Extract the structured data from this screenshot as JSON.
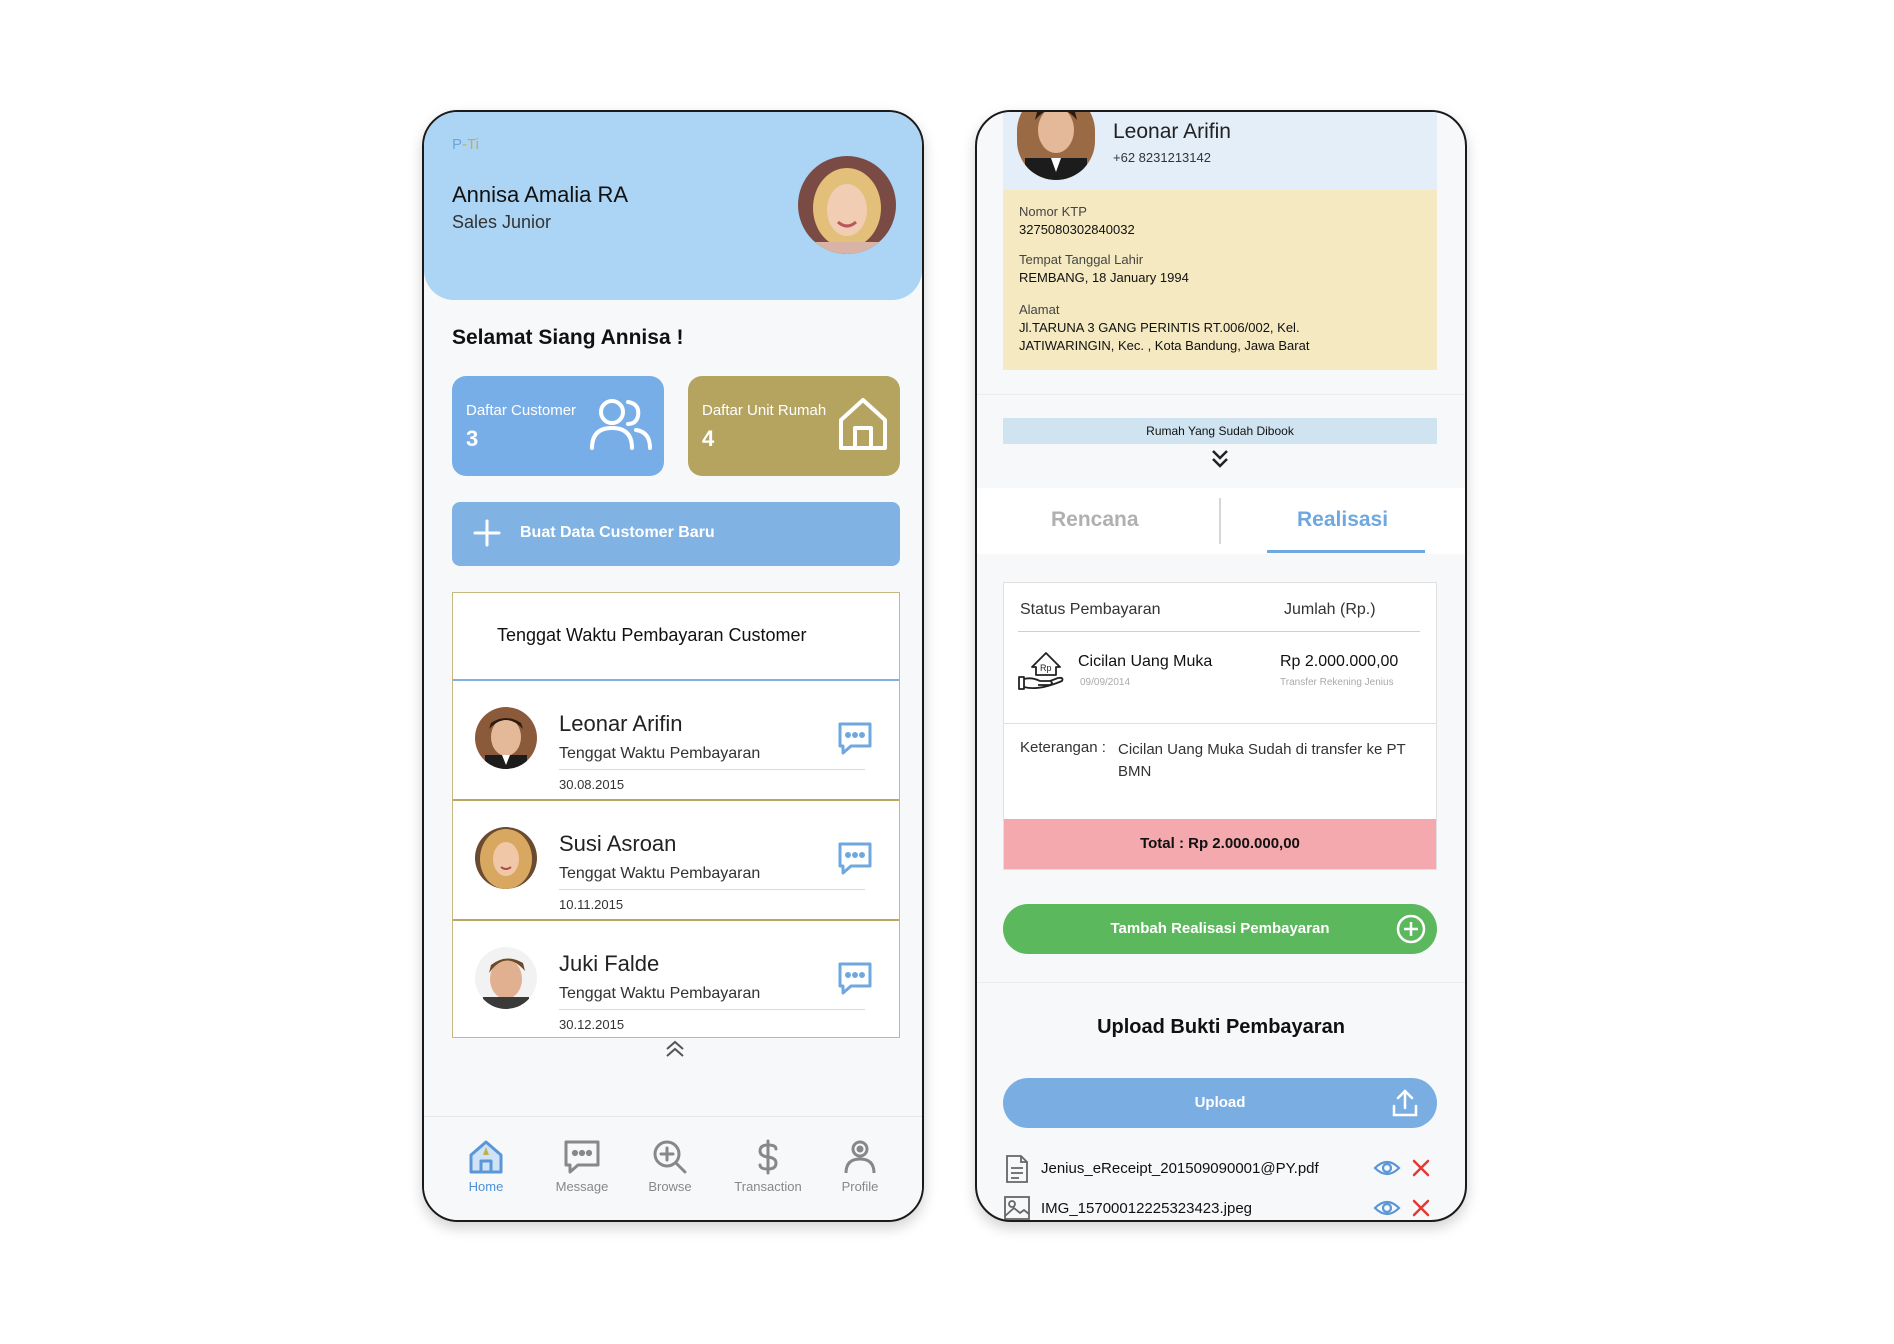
{
  "app": {
    "logo_p": "P",
    "logo_dash": "-",
    "logo_ti": "Ti"
  },
  "header": {
    "name": "Annisa Amalia RA",
    "role": "Sales Junior"
  },
  "greeting": "Selamat Siang Annisa !",
  "cards": [
    {
      "label": "Daftar Customer",
      "count": "3",
      "icon": "users-icon"
    },
    {
      "label": "Daftar Unit Rumah",
      "count": "4",
      "icon": "house-icon"
    }
  ],
  "new_customer_button": "Buat Data Customer Baru",
  "due_list": {
    "title": "Tenggat Waktu Pembayaran Customer",
    "items": [
      {
        "name": "Leonar Arifin",
        "subtitle": "Tenggat Waktu Pembayaran",
        "date": "30.08.2015"
      },
      {
        "name": "Susi Asroan",
        "subtitle": "Tenggat Waktu Pembayaran",
        "date": "10.11.2015"
      },
      {
        "name": "Juki Falde",
        "subtitle": "Tenggat Waktu Pembayaran",
        "date": "30.12.2015"
      }
    ]
  },
  "nav": [
    {
      "label": "Home",
      "icon": "home-icon",
      "active": true
    },
    {
      "label": "Message",
      "icon": "message-icon"
    },
    {
      "label": "Browse",
      "icon": "browse-icon"
    },
    {
      "label": "Transaction",
      "icon": "dollar-icon"
    },
    {
      "label": "Profile",
      "icon": "profile-icon"
    }
  ],
  "customer": {
    "name": "Leonar Arifin",
    "phone": "+62 8231213142",
    "ktp_label": "Nomor KTP",
    "ktp": "3275080302840032",
    "ttl_label": "Tempat Tanggal Lahir",
    "ttl": "REMBANG, 18 January 1994",
    "alamat_label": "Alamat",
    "alamat_1": "Jl.TARUNA 3 GANG PERINTIS RT.006/002, Kel.",
    "alamat_2": "JATIWARINGIN, Kec. , Kota Bandung, Jawa Barat"
  },
  "booked_label": "Rumah Yang Sudah Dibook",
  "tabs": {
    "rencana": "Rencana",
    "realisasi": "Realisasi"
  },
  "payment": {
    "col_status": "Status Pembayaran",
    "col_amount": "Jumlah (Rp.)",
    "item_name": "Cicilan Uang Muka",
    "item_date": "09/09/2014",
    "item_amount": "Rp 2.000.000,00",
    "item_method": "Transfer Rekening Jenius",
    "note_label": "Keterangan :",
    "note_text": "Cicilan Uang Muka Sudah di transfer ke PT BMN",
    "total": "Total : Rp 2.000.000,00",
    "icon_rp": "Rp"
  },
  "add_button": "Tambah Realisasi Pembayaran",
  "upload": {
    "title": "Upload Bukti Pembayaran",
    "button": "Upload",
    "files": [
      {
        "name": "Jenius_eReceipt_201509090001@PY.pdf",
        "icon": "document-icon"
      },
      {
        "name": "IMG_15700012225323423.jpeg",
        "icon": "image-icon"
      }
    ]
  },
  "colors": {
    "primary_blue": "#78aee8",
    "gold": "#b5a460",
    "green": "#5cb85c",
    "total_pink": "#f3a9ad",
    "header_blue": "#acd4f5",
    "info_yellow": "#f4e9c1"
  }
}
